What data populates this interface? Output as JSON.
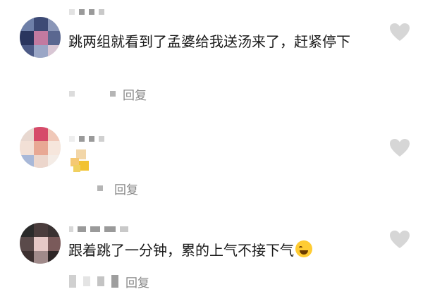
{
  "comments": [
    {
      "text": "跳两组就看到了孟婆给我送汤来了，赶紧停下",
      "reply_label": "回复"
    },
    {
      "text": "",
      "reply_label": "回复",
      "sticker": "emoji-sticker"
    },
    {
      "text": "跟着跳了一分钟，累的上气不接下气",
      "emoji": "rolling-on-floor-laughing-icon",
      "reply_label": "回复"
    }
  ],
  "icons": {
    "like": "heart-icon"
  },
  "colors": {
    "text": "#1a1a1a",
    "secondary": "#888888",
    "heart": "#d6d6d6"
  }
}
